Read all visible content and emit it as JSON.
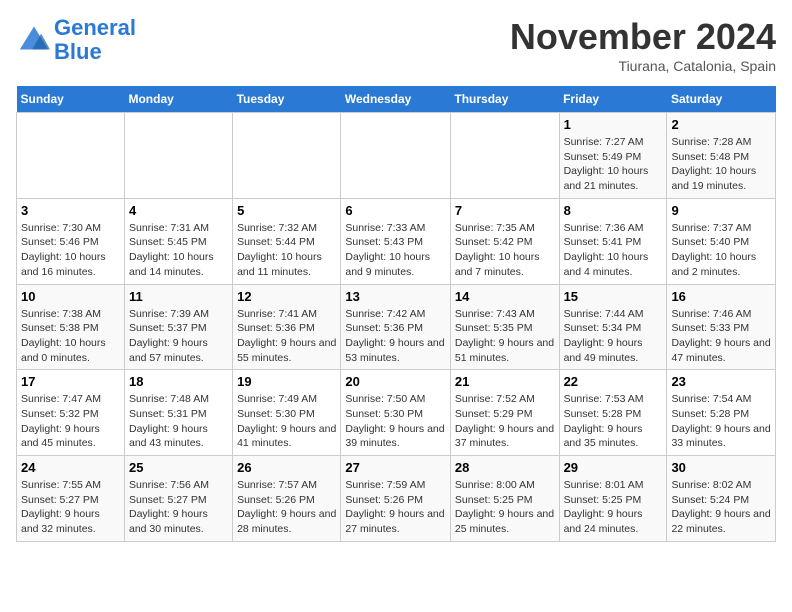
{
  "logo": {
    "text_general": "General",
    "text_blue": "Blue"
  },
  "title": "November 2024",
  "location": "Tiurana, Catalonia, Spain",
  "headers": [
    "Sunday",
    "Monday",
    "Tuesday",
    "Wednesday",
    "Thursday",
    "Friday",
    "Saturday"
  ],
  "weeks": [
    [
      {
        "day": "",
        "info": ""
      },
      {
        "day": "",
        "info": ""
      },
      {
        "day": "",
        "info": ""
      },
      {
        "day": "",
        "info": ""
      },
      {
        "day": "",
        "info": ""
      },
      {
        "day": "1",
        "info": "Sunrise: 7:27 AM\nSunset: 5:49 PM\nDaylight: 10 hours and 21 minutes."
      },
      {
        "day": "2",
        "info": "Sunrise: 7:28 AM\nSunset: 5:48 PM\nDaylight: 10 hours and 19 minutes."
      }
    ],
    [
      {
        "day": "3",
        "info": "Sunrise: 7:30 AM\nSunset: 5:46 PM\nDaylight: 10 hours and 16 minutes."
      },
      {
        "day": "4",
        "info": "Sunrise: 7:31 AM\nSunset: 5:45 PM\nDaylight: 10 hours and 14 minutes."
      },
      {
        "day": "5",
        "info": "Sunrise: 7:32 AM\nSunset: 5:44 PM\nDaylight: 10 hours and 11 minutes."
      },
      {
        "day": "6",
        "info": "Sunrise: 7:33 AM\nSunset: 5:43 PM\nDaylight: 10 hours and 9 minutes."
      },
      {
        "day": "7",
        "info": "Sunrise: 7:35 AM\nSunset: 5:42 PM\nDaylight: 10 hours and 7 minutes."
      },
      {
        "day": "8",
        "info": "Sunrise: 7:36 AM\nSunset: 5:41 PM\nDaylight: 10 hours and 4 minutes."
      },
      {
        "day": "9",
        "info": "Sunrise: 7:37 AM\nSunset: 5:40 PM\nDaylight: 10 hours and 2 minutes."
      }
    ],
    [
      {
        "day": "10",
        "info": "Sunrise: 7:38 AM\nSunset: 5:38 PM\nDaylight: 10 hours and 0 minutes."
      },
      {
        "day": "11",
        "info": "Sunrise: 7:39 AM\nSunset: 5:37 PM\nDaylight: 9 hours and 57 minutes."
      },
      {
        "day": "12",
        "info": "Sunrise: 7:41 AM\nSunset: 5:36 PM\nDaylight: 9 hours and 55 minutes."
      },
      {
        "day": "13",
        "info": "Sunrise: 7:42 AM\nSunset: 5:36 PM\nDaylight: 9 hours and 53 minutes."
      },
      {
        "day": "14",
        "info": "Sunrise: 7:43 AM\nSunset: 5:35 PM\nDaylight: 9 hours and 51 minutes."
      },
      {
        "day": "15",
        "info": "Sunrise: 7:44 AM\nSunset: 5:34 PM\nDaylight: 9 hours and 49 minutes."
      },
      {
        "day": "16",
        "info": "Sunrise: 7:46 AM\nSunset: 5:33 PM\nDaylight: 9 hours and 47 minutes."
      }
    ],
    [
      {
        "day": "17",
        "info": "Sunrise: 7:47 AM\nSunset: 5:32 PM\nDaylight: 9 hours and 45 minutes."
      },
      {
        "day": "18",
        "info": "Sunrise: 7:48 AM\nSunset: 5:31 PM\nDaylight: 9 hours and 43 minutes."
      },
      {
        "day": "19",
        "info": "Sunrise: 7:49 AM\nSunset: 5:30 PM\nDaylight: 9 hours and 41 minutes."
      },
      {
        "day": "20",
        "info": "Sunrise: 7:50 AM\nSunset: 5:30 PM\nDaylight: 9 hours and 39 minutes."
      },
      {
        "day": "21",
        "info": "Sunrise: 7:52 AM\nSunset: 5:29 PM\nDaylight: 9 hours and 37 minutes."
      },
      {
        "day": "22",
        "info": "Sunrise: 7:53 AM\nSunset: 5:28 PM\nDaylight: 9 hours and 35 minutes."
      },
      {
        "day": "23",
        "info": "Sunrise: 7:54 AM\nSunset: 5:28 PM\nDaylight: 9 hours and 33 minutes."
      }
    ],
    [
      {
        "day": "24",
        "info": "Sunrise: 7:55 AM\nSunset: 5:27 PM\nDaylight: 9 hours and 32 minutes."
      },
      {
        "day": "25",
        "info": "Sunrise: 7:56 AM\nSunset: 5:27 PM\nDaylight: 9 hours and 30 minutes."
      },
      {
        "day": "26",
        "info": "Sunrise: 7:57 AM\nSunset: 5:26 PM\nDaylight: 9 hours and 28 minutes."
      },
      {
        "day": "27",
        "info": "Sunrise: 7:59 AM\nSunset: 5:26 PM\nDaylight: 9 hours and 27 minutes."
      },
      {
        "day": "28",
        "info": "Sunrise: 8:00 AM\nSunset: 5:25 PM\nDaylight: 9 hours and 25 minutes."
      },
      {
        "day": "29",
        "info": "Sunrise: 8:01 AM\nSunset: 5:25 PM\nDaylight: 9 hours and 24 minutes."
      },
      {
        "day": "30",
        "info": "Sunrise: 8:02 AM\nSunset: 5:24 PM\nDaylight: 9 hours and 22 minutes."
      }
    ]
  ]
}
